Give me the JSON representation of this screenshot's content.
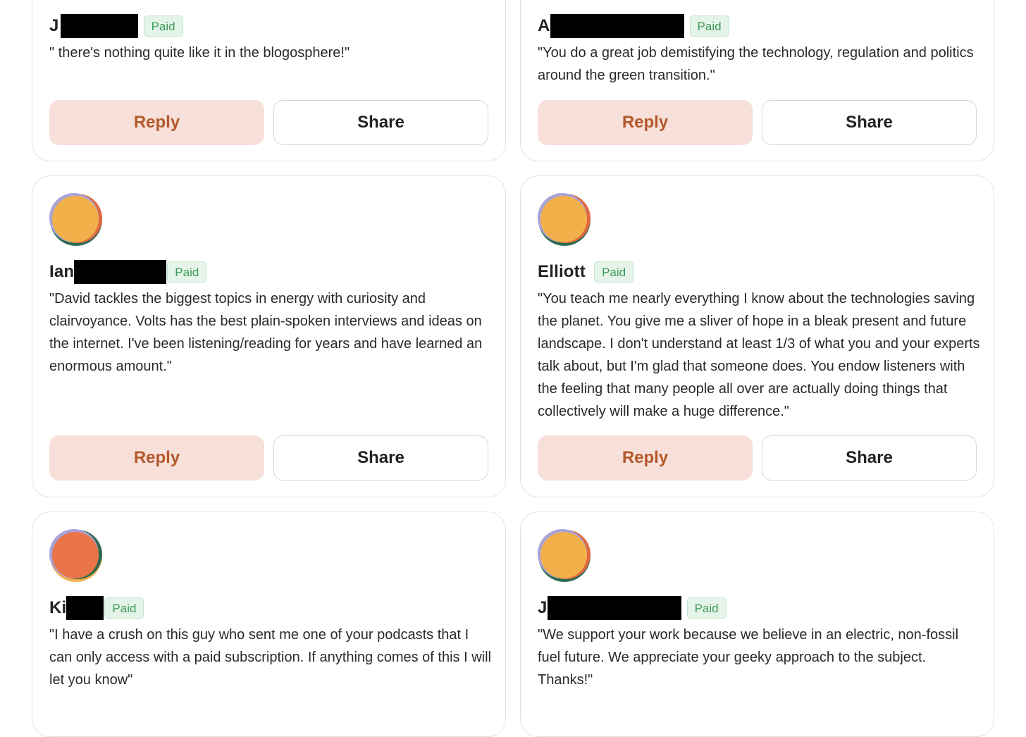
{
  "cards": [
    {
      "name": "J",
      "badge": "Paid",
      "quote": "\" there's nothing quite like it in the blogosphere!\"",
      "reply_label": "Reply",
      "share_label": "Share"
    },
    {
      "name": "A",
      "badge": "Paid",
      "quote": "\"You do a great job demistifying the technology, regulation and politics around the green transition.\"",
      "reply_label": "Reply",
      "share_label": "Share"
    },
    {
      "name": "Ian",
      "badge": "Paid",
      "quote": "\"David tackles the biggest topics in energy with curiosity and clairvoyance. Volts has the best plain-spoken interviews and ideas on the internet. I've been listening/reading for years and have learned an enormous amount.\"",
      "reply_label": "Reply",
      "share_label": "Share"
    },
    {
      "name": "Elliott",
      "badge": "Paid",
      "quote": "\"You teach me nearly everything I know about the technologies saving the planet. You give me a sliver of hope in a bleak present and future landscape. I don't understand at least 1/3 of what you and your experts talk about, but I'm glad that someone does. You endow listeners with the feeling that many people all over are actually doing things that collectively will make a huge difference.\"",
      "reply_label": "Reply",
      "share_label": "Share"
    },
    {
      "name": "Ki",
      "badge": "Paid",
      "quote": "\"I have a crush on this guy who sent me one of your podcasts that I can only access with a paid subscription. If anything comes of this I will let you know\"",
      "reply_label": "Reply",
      "share_label": "Share"
    },
    {
      "name": "J",
      "badge": "Paid",
      "quote": "\"We support your work because we believe in an electric, non-fossil fuel future. We appreciate your geeky approach to the subject. Thanks!\"",
      "reply_label": "Reply",
      "share_label": "Share"
    }
  ],
  "colors": {
    "reply_bg": "#f6e0d9",
    "reply_text": "#b4582c",
    "badge_bg": "#e4f4e8",
    "badge_text": "#3f9a5a",
    "avatar_yellow": "#f2b04a",
    "avatar_orange": "#ea7448",
    "avatar_green": "#2f6b50",
    "avatar_lavender": "#a9a2d8"
  },
  "avatar_icons": [
    "avatar-yellow-icon",
    "avatar-yellow-icon",
    "avatar-yellow-icon",
    "avatar-orange-icon",
    "avatar-yellow-icon"
  ]
}
